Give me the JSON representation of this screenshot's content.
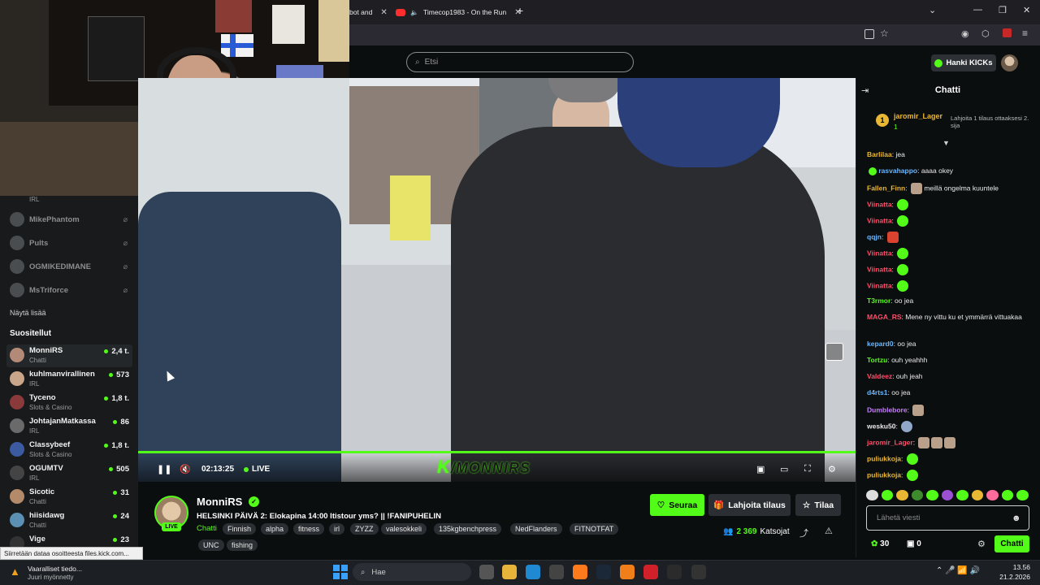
{
  "browser": {
    "tabs": [
      {
        "label": "bot and"
      },
      {
        "label": "Timecop1983 - On the Run"
      }
    ]
  },
  "header": {
    "search_placeholder": "Etsi",
    "kicks_label": "Hanki KICKs"
  },
  "sidebar": {
    "top_category": "IRL",
    "offline": [
      {
        "name": "MikePhantom"
      },
      {
        "name": "Pults"
      },
      {
        "name": "OGMIKEDIMANE"
      },
      {
        "name": "MsTriforce"
      }
    ],
    "show_more": "Näytä lisää",
    "recommended_title": "Suositellut",
    "recommended": [
      {
        "name": "MonniRS",
        "category": "Chatti",
        "viewers": "2,4 t."
      },
      {
        "name": "kuhlmanvirallinen",
        "category": "IRL",
        "viewers": "573"
      },
      {
        "name": "Tyceno",
        "category": "Slots & Casino",
        "viewers": "1,8 t."
      },
      {
        "name": "JohtajanMatkassa",
        "category": "IRL",
        "viewers": "86"
      },
      {
        "name": "Classybeef",
        "category": "Slots & Casino",
        "viewers": "1,8 t."
      },
      {
        "name": "OGUMTV",
        "category": "IRL",
        "viewers": "505"
      },
      {
        "name": "Sicotic",
        "category": "Chatti",
        "viewers": "31"
      },
      {
        "name": "hiisidawg",
        "category": "Chatti",
        "viewers": "24"
      },
      {
        "name": "Vige",
        "category": "",
        "viewers": "23"
      }
    ]
  },
  "player": {
    "timecode": "02:13:25",
    "live_label": "LIVE",
    "watermark": "/MONNIRS"
  },
  "stream": {
    "channel": "MonniRS",
    "live_badge": "LIVE",
    "title": "HELSINKI PÄIVÄ 2: Elokapina 14:00 Itistour yms? || !FANIPUHELIN",
    "category": "Chatti",
    "tags": [
      "Finnish",
      "alpha",
      "fitness",
      "irl",
      "ZYZZ",
      "valesokkeli",
      "135kgbenchpress",
      "NedFlanders",
      "FITNOTFAT",
      "UNC",
      "fishing"
    ],
    "follow_label": "Seuraa",
    "gift_label": "Lahjoita tilaus",
    "subscribe_label": "Tilaa",
    "viewer_count": "2 369",
    "viewer_label": "Katsojat"
  },
  "chat": {
    "title": "Chatti",
    "pinned": {
      "rank": "1",
      "user": "jaromir_Lager",
      "sub_rank": "1",
      "note": "Lahjoita 1 tilaus ottaaksesi 2. sija"
    },
    "messages": [
      {
        "user": "Barlilaa",
        "color": "#e9b733",
        "text": "jea"
      },
      {
        "user": "rasvahappo",
        "color": "#6ab7ff",
        "text": "aaaa okey"
      },
      {
        "user": "Fallen_Finn",
        "color": "#e9b733",
        "text": "meillä ongelma kuuntele"
      },
      {
        "user": "Viinatta",
        "color": "#ff4f6b",
        "text": ""
      },
      {
        "user": "Viinatta",
        "color": "#ff4f6b",
        "text": ""
      },
      {
        "user": "qqjn",
        "color": "#6ab7ff",
        "text": ""
      },
      {
        "user": "Viinatta",
        "color": "#ff4f6b",
        "text": ""
      },
      {
        "user": "Viinatta",
        "color": "#ff4f6b",
        "text": ""
      },
      {
        "user": "Viinatta",
        "color": "#ff4f6b",
        "text": ""
      },
      {
        "user": "T3rmor",
        "color": "#53fc18",
        "text": "oo jea"
      },
      {
        "user": "MAGA_RS",
        "color": "#ff4f6b",
        "text": "Mene ny vittu ku et ymmärrä vittuakaa"
      },
      {
        "user": "kepard0",
        "color": "#6ab7ff",
        "text": "oo jea"
      },
      {
        "user": "Tortzu",
        "color": "#53fc18",
        "text": "ouh yeahhh"
      },
      {
        "user": "Valdeez",
        "color": "#ff4f6b",
        "text": "ouh jeah"
      },
      {
        "user": "d4rts1",
        "color": "#6ab7ff",
        "text": "oo jea"
      },
      {
        "user": "Dumblebore",
        "color": "#c77dff",
        "text": ""
      },
      {
        "user": "wesku50",
        "color": "#eaeaea",
        "text": ""
      },
      {
        "user": "jaromir_Lager",
        "color": "#ff4f6b",
        "text": ""
      },
      {
        "user": "puliukkoja",
        "color": "#e9b733",
        "text": ""
      },
      {
        "user": "puliukkoja",
        "color": "#e9b733",
        "text": ""
      }
    ],
    "input_placeholder": "Lähetä viesti",
    "points": "30",
    "gifts": "0",
    "send_label": "Chatti"
  },
  "statusbar": {
    "text": "Siirretään dataa osoitteesta files.kick.com..."
  },
  "taskbar": {
    "notice_title": "Vaaralliset tiedo...",
    "notice_sub": "Juuri myönnetty",
    "search_label": "Hae",
    "time": "13.56",
    "date": "21.2.2026"
  },
  "colors": {
    "kick_green": "#53fc18",
    "background": "#0b0e0f"
  }
}
